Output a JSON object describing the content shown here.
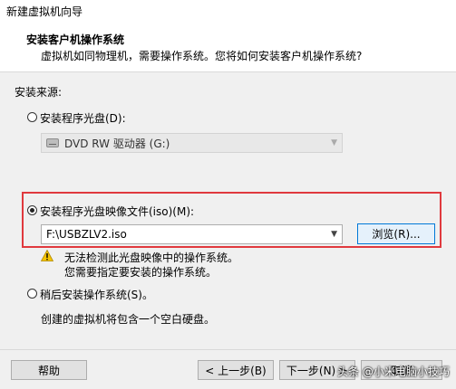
{
  "window": {
    "title": "新建虚拟机向导"
  },
  "header": {
    "title": "安装客户机操作系统",
    "subtitle": "虚拟机如同物理机，需要操作系统。您将如何安装客户机操作系统?"
  },
  "source": {
    "label": "安装来源:",
    "options": [
      {
        "label": "安装程序光盘(D):",
        "selected": false
      },
      {
        "label": "安装程序光盘映像文件(iso)(M):",
        "selected": true
      },
      {
        "label": "稍后安装操作系统(S)。",
        "selected": false
      }
    ],
    "drive": {
      "value": "DVD RW 驱动器 (G:)",
      "icon": "dvd-drive-icon"
    },
    "iso_path": {
      "value": "F:\\USBZLV2.iso"
    },
    "browse_label": "浏览(R)...",
    "warning_icon": "warning-icon",
    "warning_line1": "无法检测此光盘映像中的操作系统。",
    "warning_line2": "您需要指定要安装的操作系统。",
    "later_note": "创建的虚拟机将包含一个空白硬盘。"
  },
  "footer": {
    "help": "帮助",
    "back": "< 上一步(B)",
    "next": "下一步(N) >",
    "cancel": "取消"
  },
  "watermark": "头条 @小米电脑小技巧",
  "colors": {
    "highlight_box": "#e0393e",
    "focus_border": "#0078d7"
  }
}
